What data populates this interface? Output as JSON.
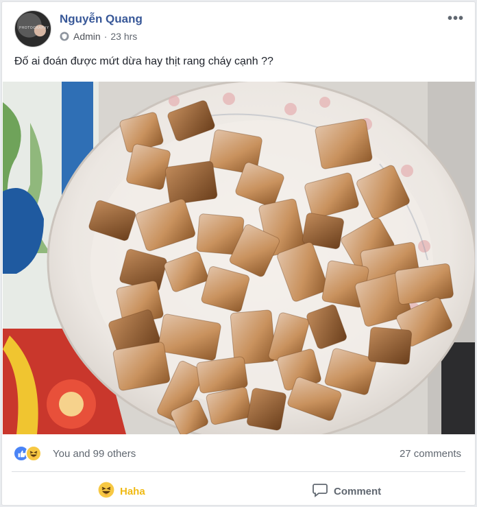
{
  "post": {
    "author": "Nguyễn Quang",
    "role": "Admin",
    "time": "23 hrs",
    "text": "Đố ai đoán được mứt dừa hay thịt rang cháy cạnh ??",
    "avatar_text": "PHOTOGRAPHY"
  },
  "reactions": {
    "summary": "You and 99 others",
    "comments": "27 comments"
  },
  "actions": {
    "haha_label": "Haha",
    "comment_label": "Comment"
  },
  "icons": {
    "admin_badge": "shield-icon",
    "like": "thumbs-up-icon",
    "haha": "laughing-face-icon",
    "comment": "speech-bubble-icon",
    "more": "ellipsis-icon"
  },
  "colors": {
    "link": "#385898",
    "muted": "#606770",
    "haha": "#f0ba15",
    "like": "#4a84f6"
  }
}
